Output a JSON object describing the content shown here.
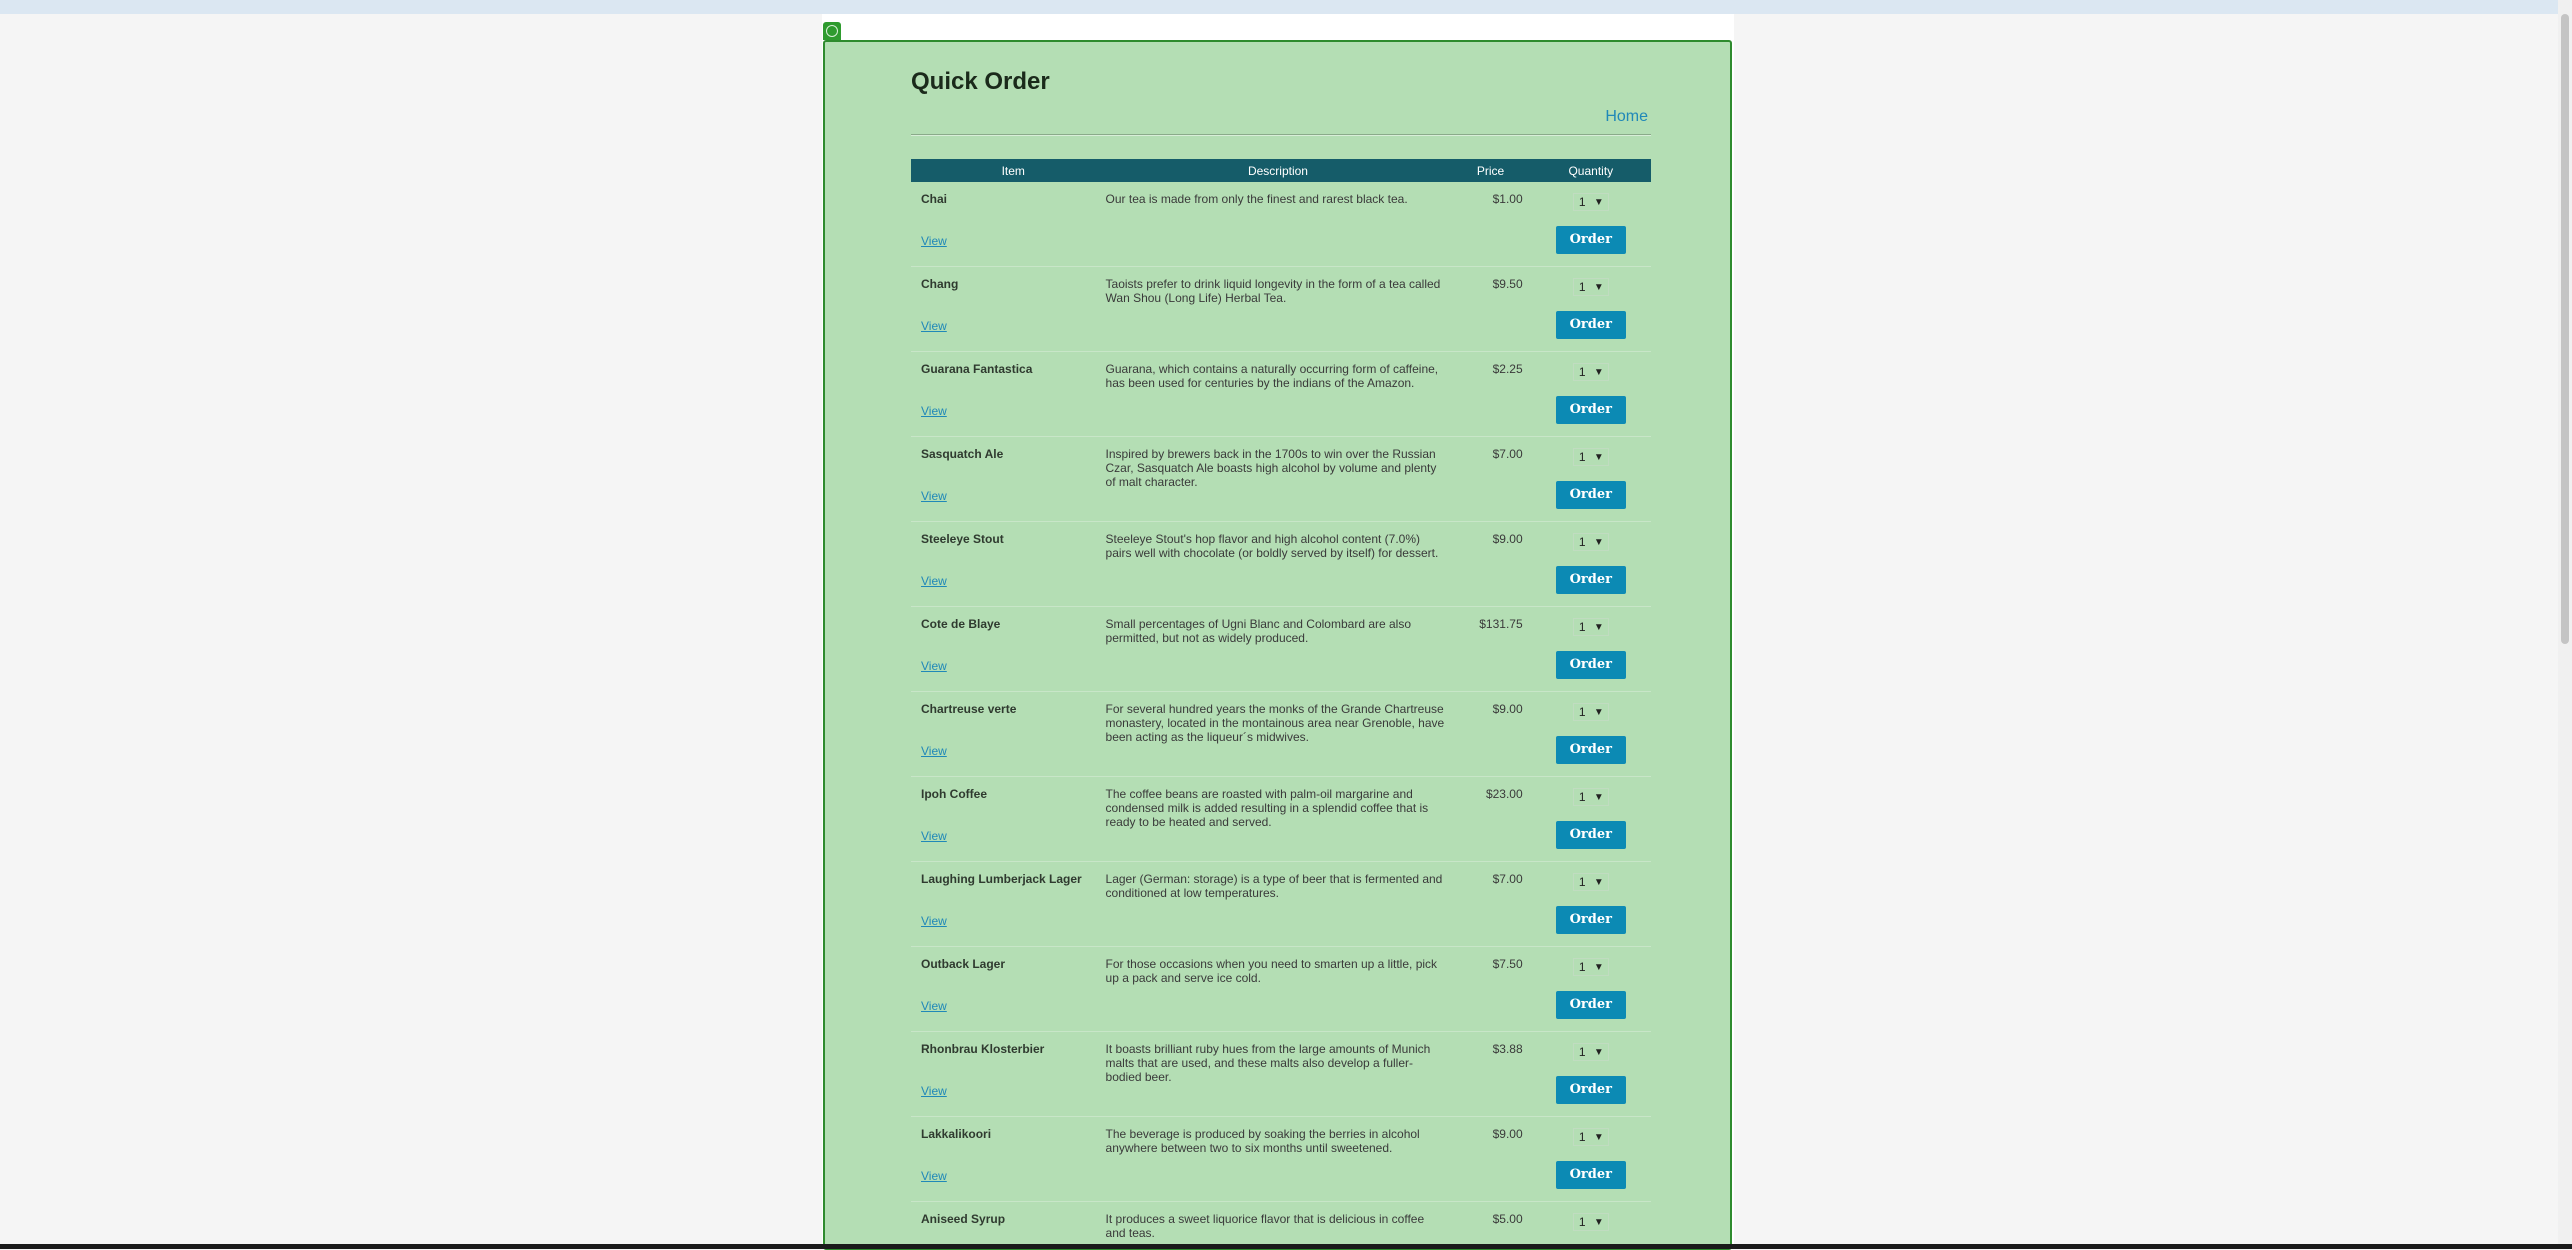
{
  "page": {
    "title": "Quick Order",
    "home_link": "Home"
  },
  "table": {
    "headers": {
      "item": "Item",
      "description": "Description",
      "price": "Price",
      "quantity": "Quantity"
    },
    "view_label": "View",
    "order_label": "Order",
    "rows": [
      {
        "item": "Chai",
        "description": "Our tea is made from only the finest and rarest black tea.",
        "price": "$1.00",
        "quantity": "1"
      },
      {
        "item": "Chang",
        "description": "Taoists prefer to drink liquid longevity in the form of a tea called Wan Shou (Long Life) Herbal Tea.",
        "price": "$9.50",
        "quantity": "1"
      },
      {
        "item": "Guarana Fantastica",
        "description": "Guarana, which contains a naturally occurring form of caffeine, has been used for centuries by the indians of the Amazon.",
        "price": "$2.25",
        "quantity": "1"
      },
      {
        "item": "Sasquatch Ale",
        "description": "Inspired by brewers back in the 1700s to win over the Russian Czar, Sasquatch Ale boasts high alcohol by volume and plenty of malt character.",
        "price": "$7.00",
        "quantity": "1"
      },
      {
        "item": "Steeleye Stout",
        "description": "Steeleye Stout's hop flavor and high alcohol content (7.0%) pairs well with chocolate (or boldly served by itself) for dessert.",
        "price": "$9.00",
        "quantity": "1"
      },
      {
        "item": "Cote de Blaye",
        "description": "Small percentages of Ugni Blanc and Colombard are also permitted, but not as widely produced.",
        "price": "$131.75",
        "quantity": "1"
      },
      {
        "item": "Chartreuse verte",
        "description": "For several hundred years the monks of the Grande Chartreuse monastery, located in the montainous area near Grenoble, have been acting as the liqueur´s midwives.",
        "price": "$9.00",
        "quantity": "1"
      },
      {
        "item": "Ipoh Coffee",
        "description": "The coffee beans are roasted with palm-oil margarine and condensed milk is added resulting in a splendid coffee that is ready to be heated and served.",
        "price": "$23.00",
        "quantity": "1"
      },
      {
        "item": "Laughing Lumberjack Lager",
        "description": "Lager (German: storage) is a type of beer that is fermented and conditioned at low temperatures.",
        "price": "$7.00",
        "quantity": "1"
      },
      {
        "item": "Outback Lager",
        "description": "For those occasions when you need to smarten up a little, pick up a pack and serve ice cold.",
        "price": "$7.50",
        "quantity": "1"
      },
      {
        "item": "Rhonbrau Klosterbier",
        "description": "It boasts brilliant ruby hues from the large amounts of Munich malts that are used, and these malts also develop a fuller-bodied beer.",
        "price": "$3.88",
        "quantity": "1"
      },
      {
        "item": "Lakkalikoori",
        "description": "The beverage is produced by soaking the berries in alcohol anywhere between two to six months until sweetened.",
        "price": "$9.00",
        "quantity": "1"
      },
      {
        "item": "Aniseed Syrup",
        "description": "It produces a sweet liquorice flavor that is delicious in coffee and teas.",
        "price": "$5.00",
        "quantity": "1"
      }
    ]
  },
  "colors": {
    "panel_bg": "#b4deb4",
    "header_bg": "#155c69",
    "order_button": "#0c8ab4",
    "link": "#2088b8"
  },
  "icons": {
    "panel_handle": "circle-icon",
    "dropdown": "chevron-down-icon"
  }
}
